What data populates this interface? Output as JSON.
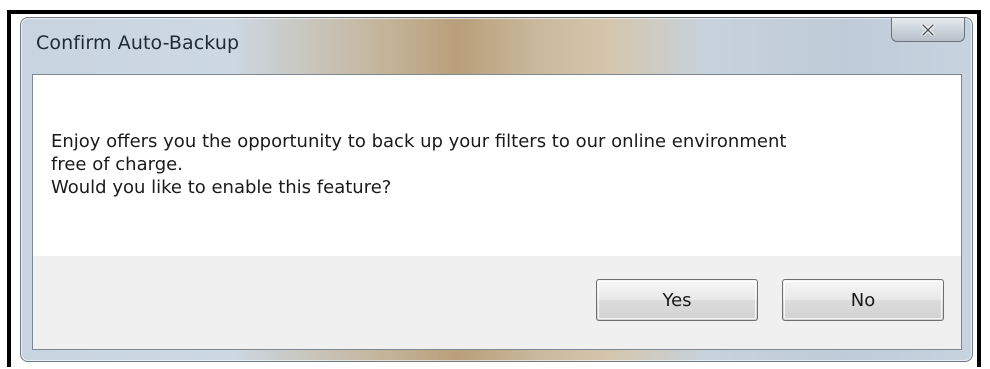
{
  "dialog": {
    "title": "Confirm Auto-Backup",
    "message": [
      "Enjoy offers you the opportunity to back up your filters to our online environment",
      "free of charge.",
      "Would you like to enable this feature?"
    ],
    "buttons": {
      "yes_label": "Yes",
      "no_label": "No"
    }
  },
  "icons": {
    "close": "close-icon"
  }
}
